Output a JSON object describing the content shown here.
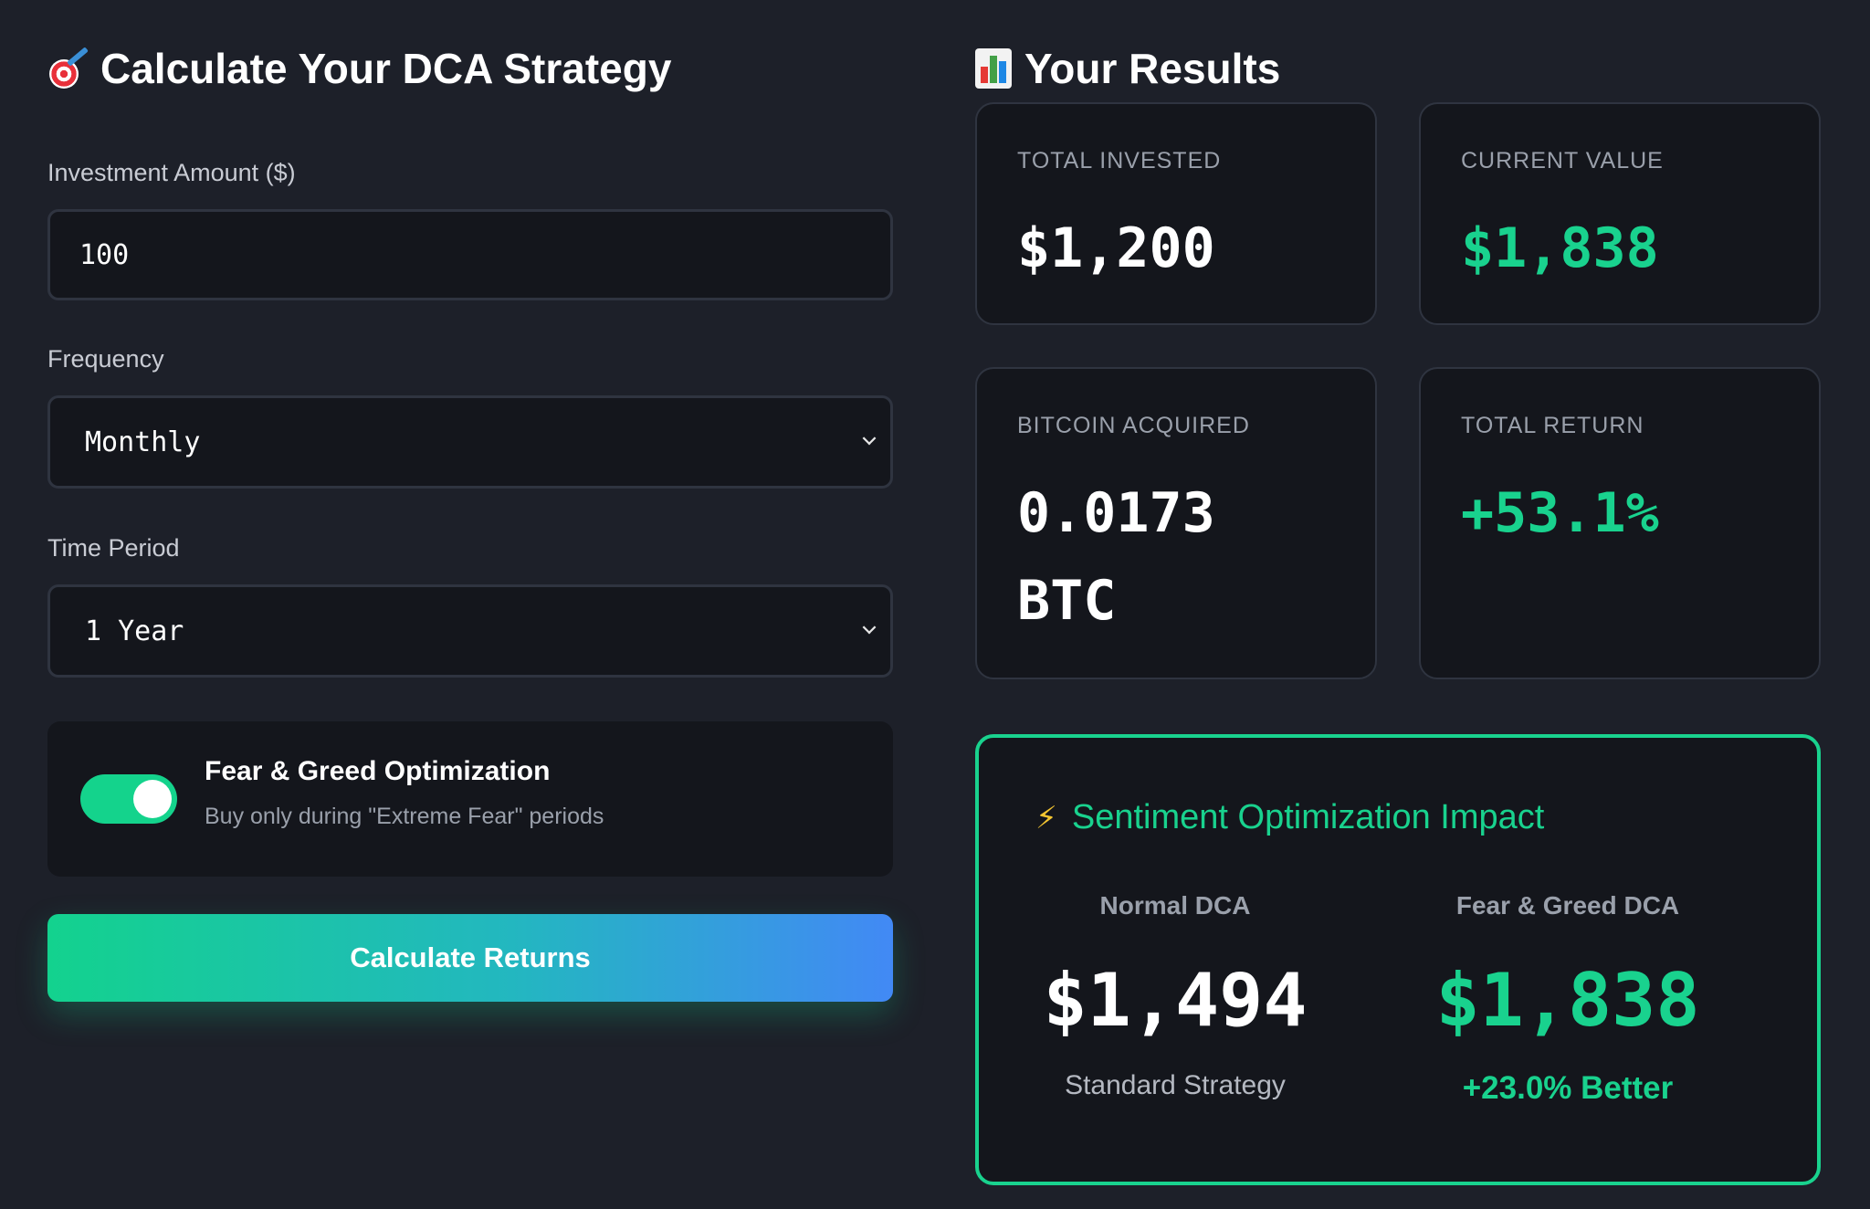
{
  "calculator": {
    "title": "Calculate Your DCA Strategy",
    "title_icon": "target-dart-icon",
    "amount_label": "Investment Amount ($)",
    "amount_value": "100",
    "frequency_label": "Frequency",
    "frequency_value": "Monthly",
    "period_label": "Time Period",
    "period_value": "1 Year",
    "optimization": {
      "enabled": true,
      "title": "Fear & Greed Optimization",
      "subtitle": "Buy only during \"Extreme Fear\" periods"
    },
    "button_label": "Calculate Returns"
  },
  "results": {
    "title": "Your Results",
    "title_icon": "bar-chart-icon",
    "total_invested": {
      "label": "TOTAL INVESTED",
      "value": "$1,200"
    },
    "current_value": {
      "label": "CURRENT VALUE",
      "value": "$1,838"
    },
    "bitcoin_acquired": {
      "label": "BITCOIN ACQUIRED",
      "value": "0.0173 BTC"
    },
    "total_return": {
      "label": "TOTAL RETURN",
      "value": "+53.1%"
    }
  },
  "impact": {
    "title": "Sentiment Optimization Impact",
    "icon": "lightning-icon",
    "normal": {
      "heading": "Normal DCA",
      "value": "$1,494",
      "caption": "Standard Strategy"
    },
    "optimized": {
      "heading": "Fear & Greed DCA",
      "value": "$1,838",
      "caption": "+23.0% Better"
    }
  },
  "colors": {
    "background": "#1d2029",
    "card": "#14161c",
    "accent_green": "#19d28e",
    "accent_blue": "#4289f5",
    "muted_text": "#9aa0ab"
  }
}
